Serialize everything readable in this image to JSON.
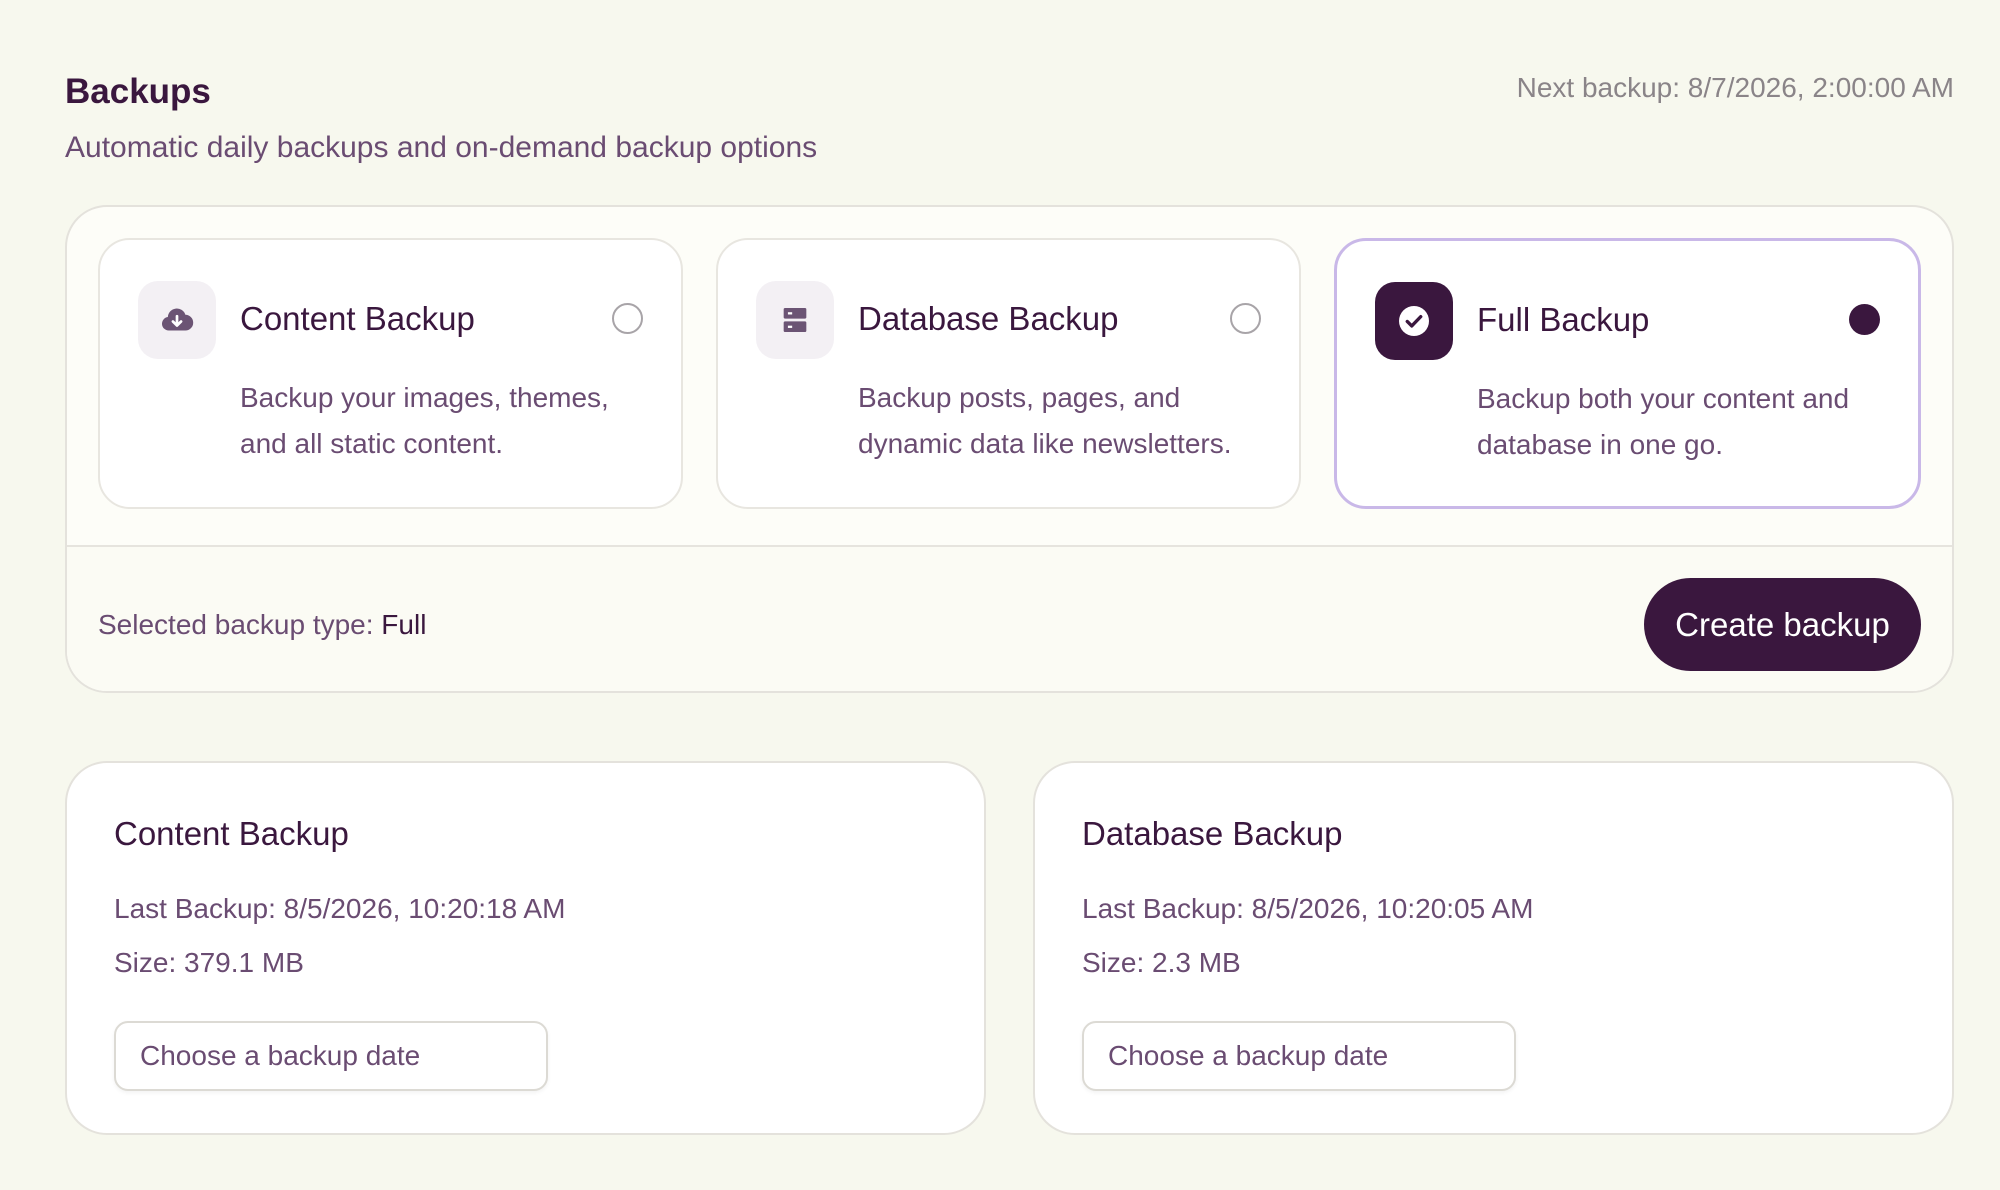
{
  "header": {
    "title": "Backups",
    "subtitle": "Automatic daily backups and on-demand backup options",
    "next_backup": "Next backup: 8/7/2026, 2:00:00 AM"
  },
  "options": [
    {
      "title": "Content Backup",
      "description": "Backup your images, themes, and all static content.",
      "icon": "cloud-download-icon",
      "selected": false
    },
    {
      "title": "Database Backup",
      "description": "Backup posts, pages, and dynamic data like newsletters.",
      "icon": "database-icon",
      "selected": false
    },
    {
      "title": "Full Backup",
      "description": "Backup both your content and database in one go.",
      "icon": "check-circle-icon",
      "selected": true
    }
  ],
  "footer": {
    "selected_label": "Selected backup type:",
    "selected_value": "Full",
    "create_button": "Create backup"
  },
  "backups": [
    {
      "title": "Content Backup",
      "last_backup": "Last Backup: 8/5/2026, 10:20:18 AM",
      "size": "Size: 379.1 MB",
      "date_placeholder": "Choose a backup date"
    },
    {
      "title": "Database Backup",
      "last_backup": "Last Backup: 8/5/2026, 10:20:05 AM",
      "size": "Size: 2.3 MB",
      "date_placeholder": "Choose a backup date"
    }
  ],
  "colors": {
    "accent": "#3a173e",
    "selected_border": "#c9b8e8",
    "background": "#f7f8ee"
  }
}
